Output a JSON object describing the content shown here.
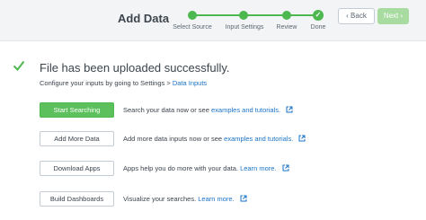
{
  "header": {
    "title": "Add Data",
    "back_label": "Back",
    "next_label": "Next",
    "back_chevron": "‹",
    "next_chevron": "›"
  },
  "wizard": {
    "steps": [
      {
        "label": "Select Source"
      },
      {
        "label": "Input Settings"
      },
      {
        "label": "Review"
      },
      {
        "label": "Done"
      }
    ],
    "done_mark": "✓"
  },
  "success": {
    "title": "File has been uploaded successfully.",
    "subtitle_prefix": "Configure your inputs by going to Settings > ",
    "subtitle_link": "Data Inputs"
  },
  "actions": [
    {
      "button": "Start Searching",
      "text": "Search your data now or see ",
      "link": "examples and tutorials."
    },
    {
      "button": "Add More Data",
      "text": "Add more data inputs now or see ",
      "link": "examples and tutorials."
    },
    {
      "button": "Download Apps",
      "text": "Apps help you do more with your data. ",
      "link": "Learn more."
    },
    {
      "button": "Build Dashboards",
      "text": "Visualize your searches. ",
      "link": "Learn more."
    }
  ],
  "colors": {
    "accent_green": "#4cb84f",
    "link_blue": "#1a73c7",
    "next_disabled": "#a8dba0"
  }
}
